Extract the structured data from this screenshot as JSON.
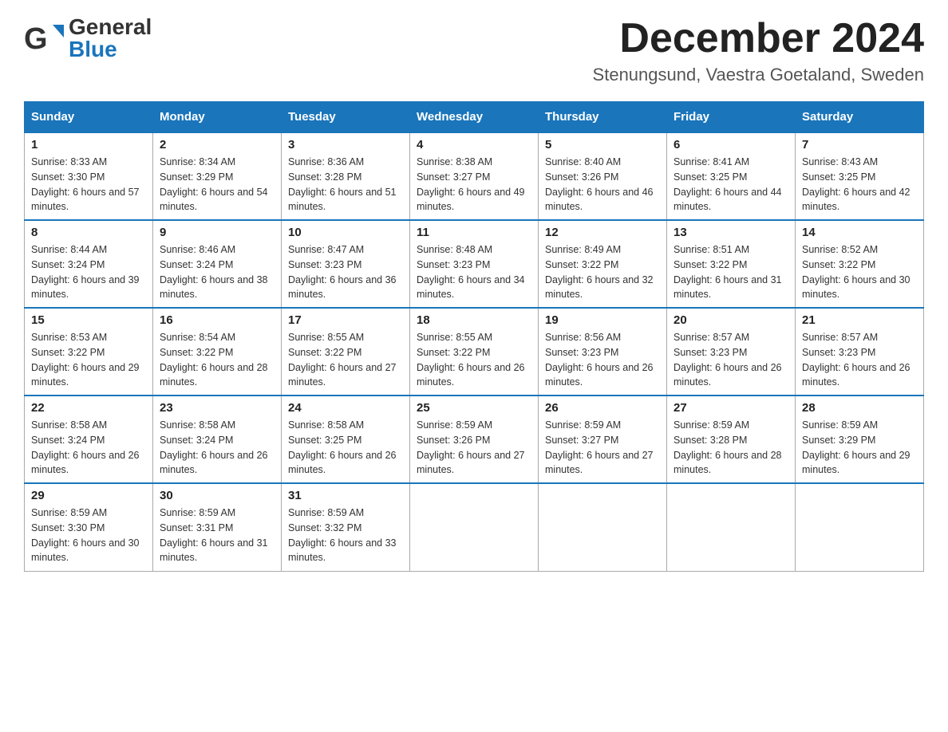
{
  "header": {
    "logo_general": "General",
    "logo_blue": "Blue",
    "month_title": "December 2024",
    "location": "Stenungsund, Vaestra Goetaland, Sweden"
  },
  "weekdays": [
    "Sunday",
    "Monday",
    "Tuesday",
    "Wednesday",
    "Thursday",
    "Friday",
    "Saturday"
  ],
  "weeks": [
    [
      {
        "day": "1",
        "sunrise": "8:33 AM",
        "sunset": "3:30 PM",
        "daylight": "6 hours and 57 minutes."
      },
      {
        "day": "2",
        "sunrise": "8:34 AM",
        "sunset": "3:29 PM",
        "daylight": "6 hours and 54 minutes."
      },
      {
        "day": "3",
        "sunrise": "8:36 AM",
        "sunset": "3:28 PM",
        "daylight": "6 hours and 51 minutes."
      },
      {
        "day": "4",
        "sunrise": "8:38 AM",
        "sunset": "3:27 PM",
        "daylight": "6 hours and 49 minutes."
      },
      {
        "day": "5",
        "sunrise": "8:40 AM",
        "sunset": "3:26 PM",
        "daylight": "6 hours and 46 minutes."
      },
      {
        "day": "6",
        "sunrise": "8:41 AM",
        "sunset": "3:25 PM",
        "daylight": "6 hours and 44 minutes."
      },
      {
        "day": "7",
        "sunrise": "8:43 AM",
        "sunset": "3:25 PM",
        "daylight": "6 hours and 42 minutes."
      }
    ],
    [
      {
        "day": "8",
        "sunrise": "8:44 AM",
        "sunset": "3:24 PM",
        "daylight": "6 hours and 39 minutes."
      },
      {
        "day": "9",
        "sunrise": "8:46 AM",
        "sunset": "3:24 PM",
        "daylight": "6 hours and 38 minutes."
      },
      {
        "day": "10",
        "sunrise": "8:47 AM",
        "sunset": "3:23 PM",
        "daylight": "6 hours and 36 minutes."
      },
      {
        "day": "11",
        "sunrise": "8:48 AM",
        "sunset": "3:23 PM",
        "daylight": "6 hours and 34 minutes."
      },
      {
        "day": "12",
        "sunrise": "8:49 AM",
        "sunset": "3:22 PM",
        "daylight": "6 hours and 32 minutes."
      },
      {
        "day": "13",
        "sunrise": "8:51 AM",
        "sunset": "3:22 PM",
        "daylight": "6 hours and 31 minutes."
      },
      {
        "day": "14",
        "sunrise": "8:52 AM",
        "sunset": "3:22 PM",
        "daylight": "6 hours and 30 minutes."
      }
    ],
    [
      {
        "day": "15",
        "sunrise": "8:53 AM",
        "sunset": "3:22 PM",
        "daylight": "6 hours and 29 minutes."
      },
      {
        "day": "16",
        "sunrise": "8:54 AM",
        "sunset": "3:22 PM",
        "daylight": "6 hours and 28 minutes."
      },
      {
        "day": "17",
        "sunrise": "8:55 AM",
        "sunset": "3:22 PM",
        "daylight": "6 hours and 27 minutes."
      },
      {
        "day": "18",
        "sunrise": "8:55 AM",
        "sunset": "3:22 PM",
        "daylight": "6 hours and 26 minutes."
      },
      {
        "day": "19",
        "sunrise": "8:56 AM",
        "sunset": "3:23 PM",
        "daylight": "6 hours and 26 minutes."
      },
      {
        "day": "20",
        "sunrise": "8:57 AM",
        "sunset": "3:23 PM",
        "daylight": "6 hours and 26 minutes."
      },
      {
        "day": "21",
        "sunrise": "8:57 AM",
        "sunset": "3:23 PM",
        "daylight": "6 hours and 26 minutes."
      }
    ],
    [
      {
        "day": "22",
        "sunrise": "8:58 AM",
        "sunset": "3:24 PM",
        "daylight": "6 hours and 26 minutes."
      },
      {
        "day": "23",
        "sunrise": "8:58 AM",
        "sunset": "3:24 PM",
        "daylight": "6 hours and 26 minutes."
      },
      {
        "day": "24",
        "sunrise": "8:58 AM",
        "sunset": "3:25 PM",
        "daylight": "6 hours and 26 minutes."
      },
      {
        "day": "25",
        "sunrise": "8:59 AM",
        "sunset": "3:26 PM",
        "daylight": "6 hours and 27 minutes."
      },
      {
        "day": "26",
        "sunrise": "8:59 AM",
        "sunset": "3:27 PM",
        "daylight": "6 hours and 27 minutes."
      },
      {
        "day": "27",
        "sunrise": "8:59 AM",
        "sunset": "3:28 PM",
        "daylight": "6 hours and 28 minutes."
      },
      {
        "day": "28",
        "sunrise": "8:59 AM",
        "sunset": "3:29 PM",
        "daylight": "6 hours and 29 minutes."
      }
    ],
    [
      {
        "day": "29",
        "sunrise": "8:59 AM",
        "sunset": "3:30 PM",
        "daylight": "6 hours and 30 minutes."
      },
      {
        "day": "30",
        "sunrise": "8:59 AM",
        "sunset": "3:31 PM",
        "daylight": "6 hours and 31 minutes."
      },
      {
        "day": "31",
        "sunrise": "8:59 AM",
        "sunset": "3:32 PM",
        "daylight": "6 hours and 33 minutes."
      },
      null,
      null,
      null,
      null
    ]
  ]
}
